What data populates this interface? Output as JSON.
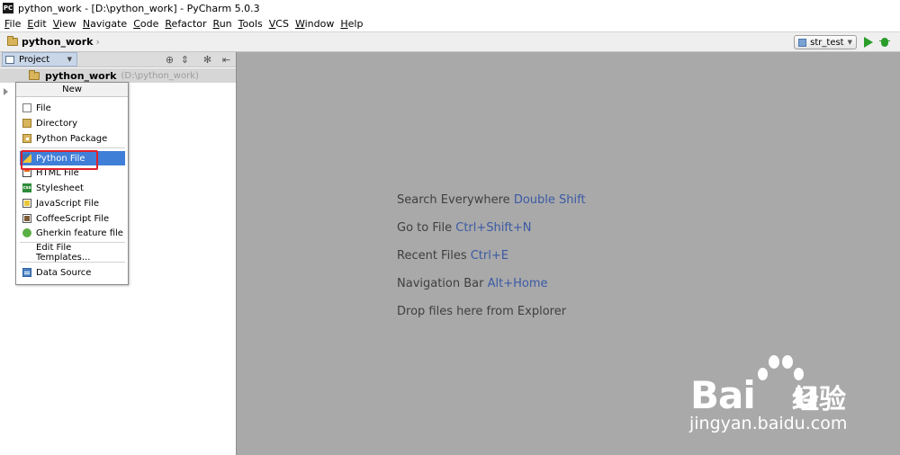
{
  "window": {
    "title": "python_work - [D:\\python_work] - PyCharm 5.0.3",
    "app_badge": "PC"
  },
  "menu": [
    {
      "mnemonic": "F",
      "rest": "ile"
    },
    {
      "mnemonic": "E",
      "rest": "dit"
    },
    {
      "mnemonic": "V",
      "rest": "iew"
    },
    {
      "mnemonic": "N",
      "rest": "avigate"
    },
    {
      "mnemonic": "C",
      "rest": "ode"
    },
    {
      "mnemonic": "R",
      "rest": "efactor"
    },
    {
      "mnemonic": "R",
      "rest": "un"
    },
    {
      "mnemonic": "T",
      "rest": "ools"
    },
    {
      "mnemonic": "V",
      "rest": "CS"
    },
    {
      "mnemonic": "W",
      "rest": "indow"
    },
    {
      "mnemonic": "H",
      "rest": "elp"
    }
  ],
  "navbar": {
    "breadcrumb": "python_work",
    "run_config": "str_test"
  },
  "project_panel": {
    "tab_label": "Project",
    "root_name": "python_work",
    "root_path": "(D:\\python_work)"
  },
  "new_menu": {
    "header": "New",
    "items": [
      {
        "label": "File",
        "icon": "file-icon"
      },
      {
        "label": "Directory",
        "icon": "folder-icon"
      },
      {
        "label": "Python Package",
        "icon": "python-package-icon"
      },
      {
        "label": "Python File",
        "icon": "python-file-icon",
        "selected": true
      },
      {
        "label": "HTML File",
        "icon": "html-file-icon"
      },
      {
        "label": "Stylesheet",
        "icon": "stylesheet-icon",
        "icon_text": "css"
      },
      {
        "label": "JavaScript File",
        "icon": "javascript-file-icon"
      },
      {
        "label": "CoffeeScript File",
        "icon": "coffeescript-file-icon"
      },
      {
        "label": "Gherkin feature file",
        "icon": "gherkin-file-icon"
      },
      {
        "label": "Edit File Templates...",
        "icon": ""
      },
      {
        "label": "Data Source",
        "icon": "data-source-icon"
      }
    ]
  },
  "editor_hints": [
    {
      "text": "Search Everywhere",
      "shortcut": "Double Shift"
    },
    {
      "text": "Go to File",
      "shortcut": "Ctrl+Shift+N"
    },
    {
      "text": "Recent Files",
      "shortcut": "Ctrl+E"
    },
    {
      "text": "Navigation Bar",
      "shortcut": "Alt+Home"
    },
    {
      "text": "Drop files here from Explorer",
      "shortcut": ""
    }
  ],
  "watermark": {
    "brand": "Bai",
    "brand_end": "u",
    "cn": "经验",
    "url": "jingyan.baidu.com"
  },
  "colors": {
    "selection": "#3f7fd8",
    "shortcut": "#3b5aa5",
    "highlight_box": "#e0202b",
    "editor_bg": "#a9a9a9"
  }
}
